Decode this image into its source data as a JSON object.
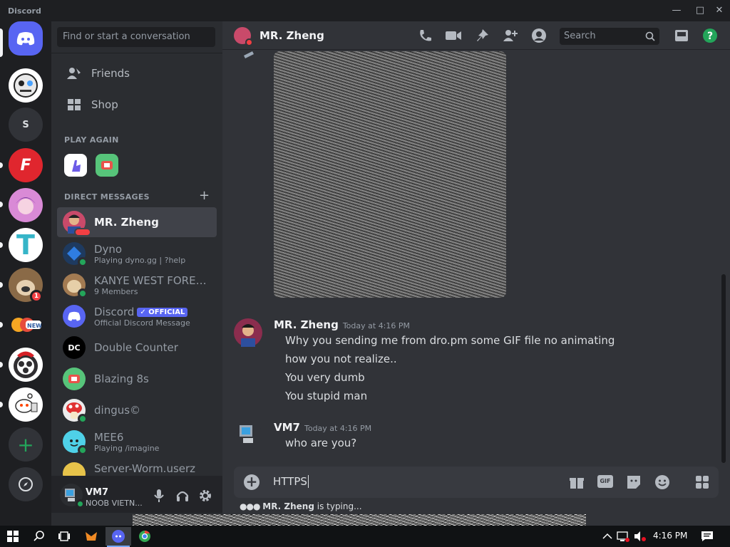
{
  "window": {
    "title": "Discord"
  },
  "dm_sidebar": {
    "search_placeholder": "Find or start a conversation",
    "nav": [
      {
        "label": "Friends"
      },
      {
        "label": "Shop"
      }
    ],
    "play_again_header": "PLAY AGAIN",
    "dm_header": "DIRECT MESSAGES",
    "dms": [
      {
        "name": "MR. Zheng",
        "sub": "",
        "selected": true
      },
      {
        "name": "Dyno",
        "sub": "Playing dyno.gg | ?help"
      },
      {
        "name": "KANYE WEST FOREV...",
        "sub": "9 Members"
      },
      {
        "name": "Discord",
        "badge": "OFFICIAL",
        "sub": "Official Discord Message"
      },
      {
        "name": "Double Counter",
        "sub": ""
      },
      {
        "name": "Blazing 8s",
        "sub": ""
      },
      {
        "name": "dingus©",
        "sub": ""
      },
      {
        "name": "MEE6",
        "sub": "Playing /imagine"
      },
      {
        "name": "Server-Worm.userz",
        "sub": ""
      }
    ]
  },
  "servers": {
    "letter_server": "S",
    "mention_count": "1"
  },
  "user_panel": {
    "username": "VM7",
    "status": "NOOB VIETN..."
  },
  "chat": {
    "channel_name": "MR. Zheng",
    "search_placeholder": "Search",
    "messages": [
      {
        "author": "MR. Zheng",
        "time": "Today at 4:16 PM",
        "lines": [
          "Why you sending me from dro.pm some GIF file no animating",
          "how you not realize..",
          "You very dumb",
          "You stupid man"
        ]
      },
      {
        "author": "VM7",
        "time": "Today at 4:16 PM",
        "lines": [
          "who are you?"
        ]
      }
    ],
    "composer_value": "HTTPS",
    "typing_user": "MR. Zheng",
    "typing_suffix": "is typing..."
  },
  "taskbar": {
    "time": "4:16 PM"
  },
  "colors": {
    "accent": "#5865f2",
    "online": "#23a55a",
    "help": "#23a55a",
    "mention": "#f23f43"
  }
}
